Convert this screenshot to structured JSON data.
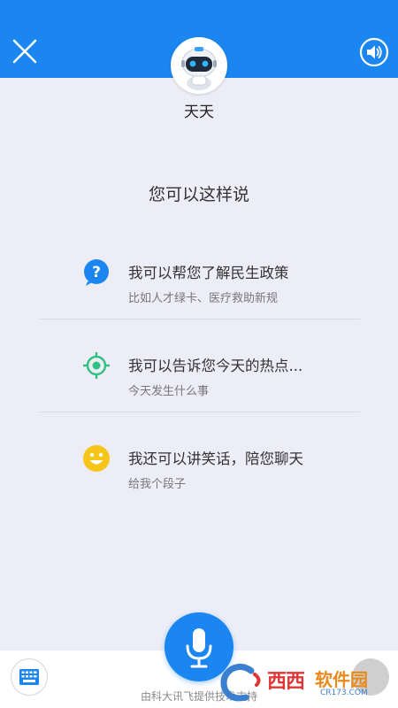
{
  "header": {
    "bot_name": "天天",
    "accent_color": "#1b86f0"
  },
  "main": {
    "prompt_title": "您可以这样说",
    "suggestions": [
      {
        "icon": "question-icon",
        "title": "我可以帮您了解民生政策",
        "subtitle": "比如人才绿卡、医疗救助新规"
      },
      {
        "icon": "target-icon",
        "title": "我可以告诉您今天的热点...",
        "subtitle": "今天发生什么事"
      },
      {
        "icon": "smiley-icon",
        "title": "我还可以讲笑话，陪您聊天",
        "subtitle": "给我个段子"
      }
    ]
  },
  "footer": {
    "note": "由科大讯飞提供技术支持"
  },
  "watermark": {
    "text1": "西西",
    "text2": "软件园",
    "url": "CR173.COM"
  }
}
